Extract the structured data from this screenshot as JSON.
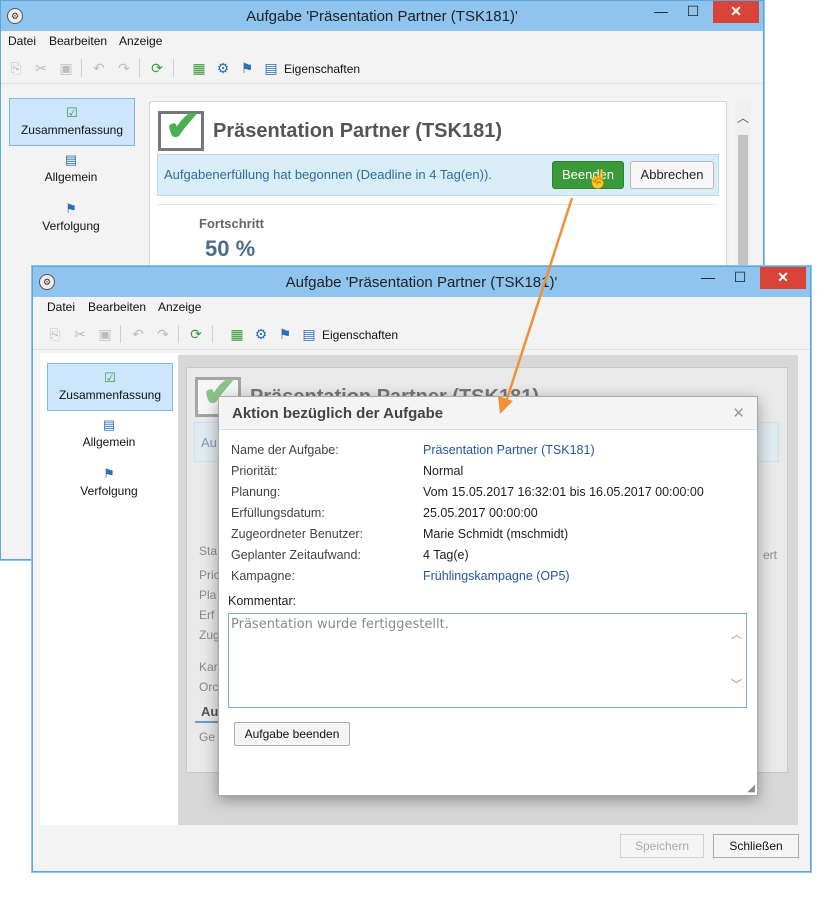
{
  "back_window": {
    "title": "Aufgabe 'Präsentation Partner (TSK181)'",
    "menu": [
      "Datei",
      "Bearbeiten",
      "Anzeige"
    ],
    "toolbar_label": "Eigenschaften",
    "nav": [
      {
        "label": "Zusammenfassung",
        "icon": "checkmark-icon"
      },
      {
        "label": "Allgemein",
        "icon": "clipboard-icon"
      },
      {
        "label": "Verfolgung",
        "icon": "tracking-icon"
      }
    ],
    "task_title": "Präsentation Partner (TSK181)",
    "banner_text": "Aufgabenerfüllung hat begonnen (Deadline in 4 Tag(en)).",
    "finish_button": "Beenden",
    "cancel_button": "Abbrechen",
    "progress_label": "Fortschritt",
    "progress_value": "50 %"
  },
  "front_window": {
    "title": "Aufgabe 'Präsentation Partner (TSK181)'",
    "menu": [
      "Datei",
      "Bearbeiten",
      "Anzeige"
    ],
    "toolbar_label": "Eigenschaften",
    "nav": [
      {
        "label": "Zusammenfassung",
        "icon": "checkmark-icon"
      },
      {
        "label": "Allgemein",
        "icon": "clipboard-icon"
      },
      {
        "label": "Verfolgung",
        "icon": "tracking-icon"
      }
    ],
    "task_title": "Präsentation Partner (TSK181)",
    "ghost": {
      "banner_start": "Au",
      "status": "Sta",
      "prio": "Pric",
      "pla": "Pla",
      "erf": "Erf",
      "zug": "Zug",
      "kan": "Kar",
      "ord": "Orc",
      "section": "Au",
      "ge": "Ge",
      "right": "ert"
    },
    "save_button": "Speichern",
    "close_button": "Schließen"
  },
  "dialog": {
    "title": "Aktion bezüglich der Aufgabe",
    "rows": [
      {
        "label": "Name der Aufgabe:",
        "value": "Präsentation Partner (TSK181)",
        "link": true
      },
      {
        "label": "Priorität:",
        "value": "Normal",
        "link": false
      },
      {
        "label": "Planung:",
        "value": "Vom 15.05.2017 16:32:01 bis 16.05.2017 00:00:00",
        "link": false
      },
      {
        "label": "Erfüllungsdatum:",
        "value": "25.05.2017 00:00:00",
        "link": false
      },
      {
        "label": "Zugeordneter Benutzer:",
        "value": "Marie Schmidt (mschmidt)",
        "link": false
      },
      {
        "label": "Geplanter Zeitaufwand:",
        "value": "4 Tag(e)",
        "link": false
      },
      {
        "label": "Kampagne:",
        "value": "Frühlingskampagne (OP5)",
        "link": true
      }
    ],
    "comment_label": "Kommentar:",
    "comment_text": "Präsentation wurde fertiggestellt.",
    "submit_button": "Aufgabe beenden"
  },
  "colors": {
    "title_bar": "#8fc4ef",
    "accent_green": "#3a9a3a",
    "close_red": "#d9443a",
    "arrow_orange": "#f0913a",
    "link_blue": "#24569c"
  }
}
